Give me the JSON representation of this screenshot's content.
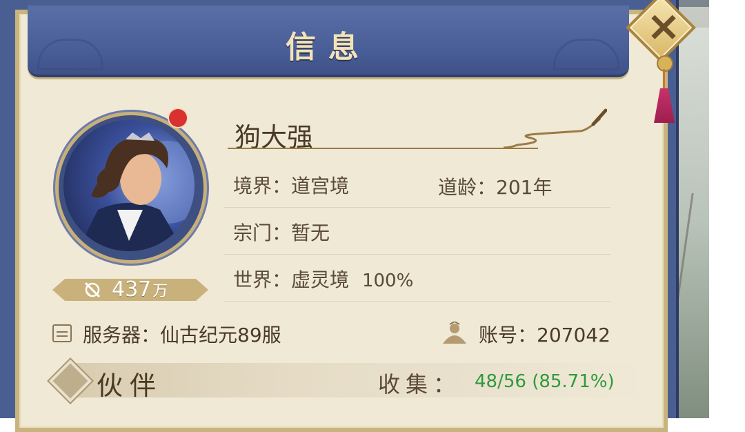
{
  "panel": {
    "title": "信息"
  },
  "profile": {
    "name": "狗大强",
    "power_value": "437",
    "power_unit": "万",
    "realm_label": "境界：",
    "realm_value": "道宫境",
    "age_label": "道龄：",
    "age_value": "201年",
    "sect_label": "宗门：",
    "sect_value": "暂无",
    "world_label": "世界：",
    "world_value": "虚灵境",
    "world_progress": "100%"
  },
  "server": {
    "label": "服务器：",
    "value": "仙古纪元89服"
  },
  "account": {
    "label": "账号：",
    "value": "207042"
  },
  "companion": {
    "label": "伙伴",
    "collect_label": "收集：",
    "collect_value": "48/56 (85.71%)"
  },
  "icons": {
    "close": "close-icon",
    "power": "sword-shield-icon",
    "server": "notepad-icon",
    "account": "character-icon"
  },
  "colors": {
    "frame_blue": "#4a5f91",
    "parchment": "#efe9d6",
    "gold_border": "#c9b47e",
    "notification_red": "#d8312f",
    "collect_green": "#2f9a3a"
  }
}
